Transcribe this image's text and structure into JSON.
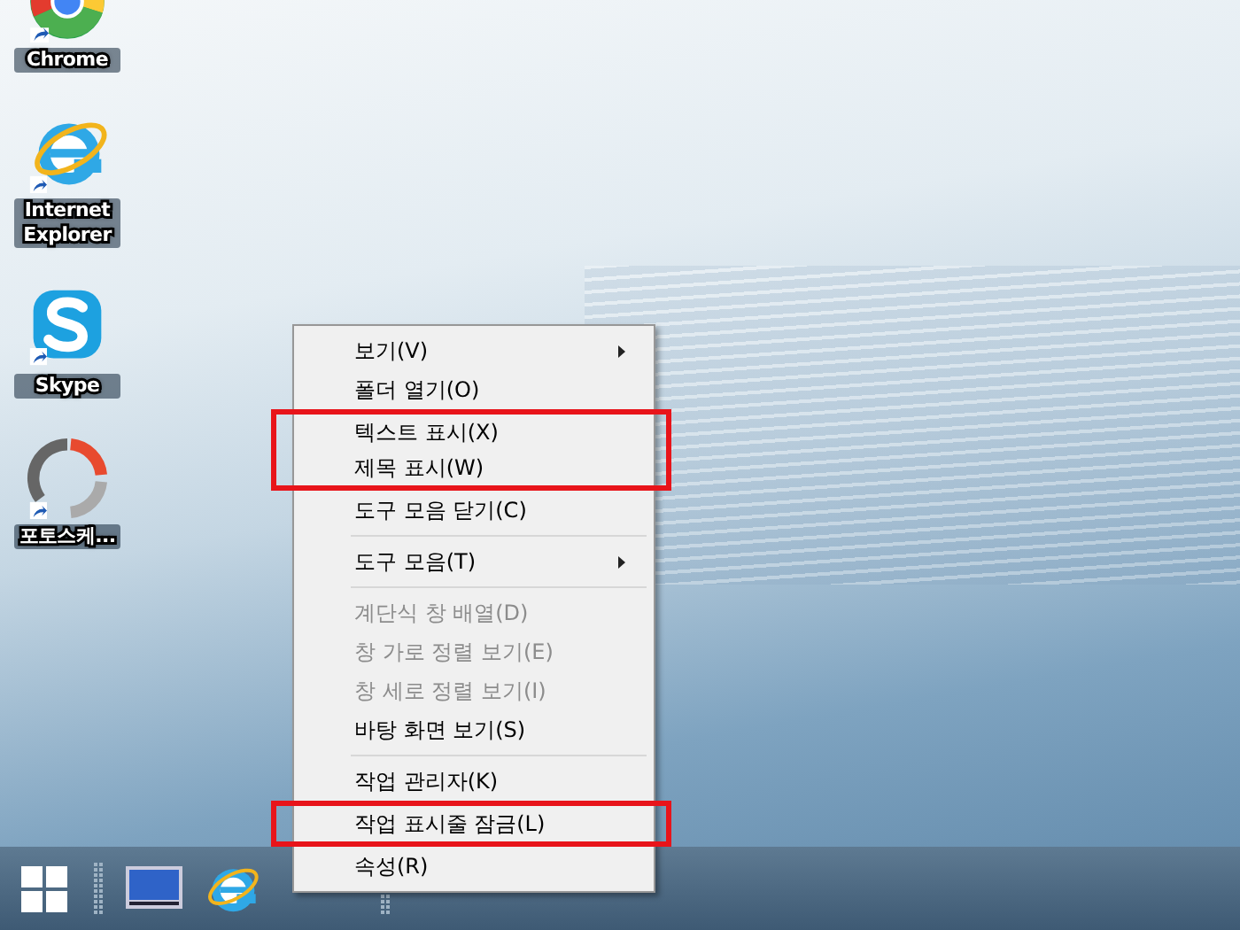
{
  "desktop_icons": [
    {
      "kind": "chrome",
      "label": "Chrome"
    },
    {
      "kind": "ie",
      "label": "Internet Explorer"
    },
    {
      "kind": "skype",
      "label": "Skype"
    },
    {
      "kind": "photoscape",
      "label": "포토스케..."
    }
  ],
  "context_menu": {
    "sections": [
      {
        "items": [
          {
            "label": "보기(V)",
            "submenu": true,
            "disabled": false,
            "highlighted": false
          },
          {
            "label": "폴더 열기(O)",
            "submenu": false,
            "disabled": false,
            "highlighted": false
          },
          {
            "label": "텍스트 표시(X)",
            "submenu": false,
            "disabled": false,
            "highlighted": true
          },
          {
            "label": "제목 표시(W)",
            "submenu": false,
            "disabled": false,
            "highlighted": true
          },
          {
            "label": "도구 모음 닫기(C)",
            "submenu": false,
            "disabled": false,
            "highlighted": false
          }
        ]
      },
      {
        "items": [
          {
            "label": "도구 모음(T)",
            "submenu": true,
            "disabled": false,
            "highlighted": false
          }
        ]
      },
      {
        "items": [
          {
            "label": "계단식 창 배열(D)",
            "submenu": false,
            "disabled": true,
            "highlighted": false
          },
          {
            "label": "창 가로 정렬 보기(E)",
            "submenu": false,
            "disabled": true,
            "highlighted": false
          },
          {
            "label": "창 세로 정렬 보기(I)",
            "submenu": false,
            "disabled": true,
            "highlighted": false
          },
          {
            "label": "바탕 화면 보기(S)",
            "submenu": false,
            "disabled": false,
            "highlighted": false
          }
        ]
      },
      {
        "items": [
          {
            "label": "작업 관리자(K)",
            "submenu": false,
            "disabled": false,
            "highlighted": false
          },
          {
            "label": "작업 표시줄 잠금(L)",
            "submenu": false,
            "disabled": false,
            "highlighted": true
          },
          {
            "label": "속성(R)",
            "submenu": false,
            "disabled": false,
            "highlighted": false
          }
        ]
      }
    ]
  }
}
